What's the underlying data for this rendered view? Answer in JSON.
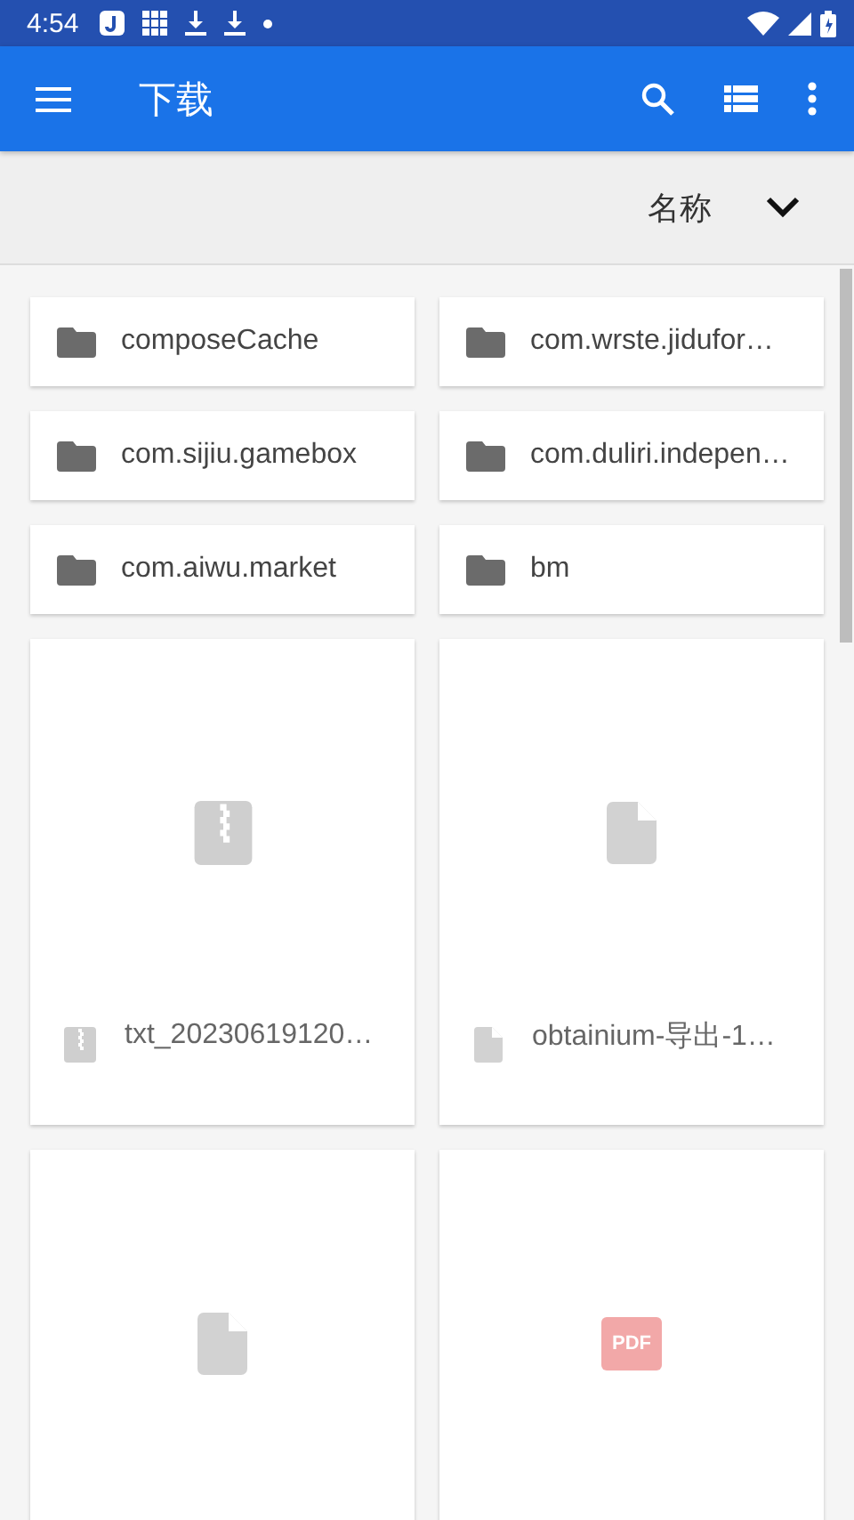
{
  "status_bar": {
    "time": "4:54"
  },
  "app_bar": {
    "title": "下载"
  },
  "sort_bar": {
    "label": "名称"
  },
  "items": [
    {
      "kind": "folder",
      "name": "composeCache"
    },
    {
      "kind": "folder",
      "name": "com.wrste.jidufor…"
    },
    {
      "kind": "folder",
      "name": "com.sijiu.gamebox"
    },
    {
      "kind": "folder",
      "name": "com.duliri.indepen…"
    },
    {
      "kind": "folder",
      "name": "com.aiwu.market"
    },
    {
      "kind": "folder",
      "name": "bm"
    },
    {
      "kind": "archive",
      "name": "txt_20230619120…"
    },
    {
      "kind": "document",
      "name": "obtainium-导出-1…"
    },
    {
      "kind": "document"
    },
    {
      "kind": "pdf",
      "badge": "PDF"
    }
  ]
}
